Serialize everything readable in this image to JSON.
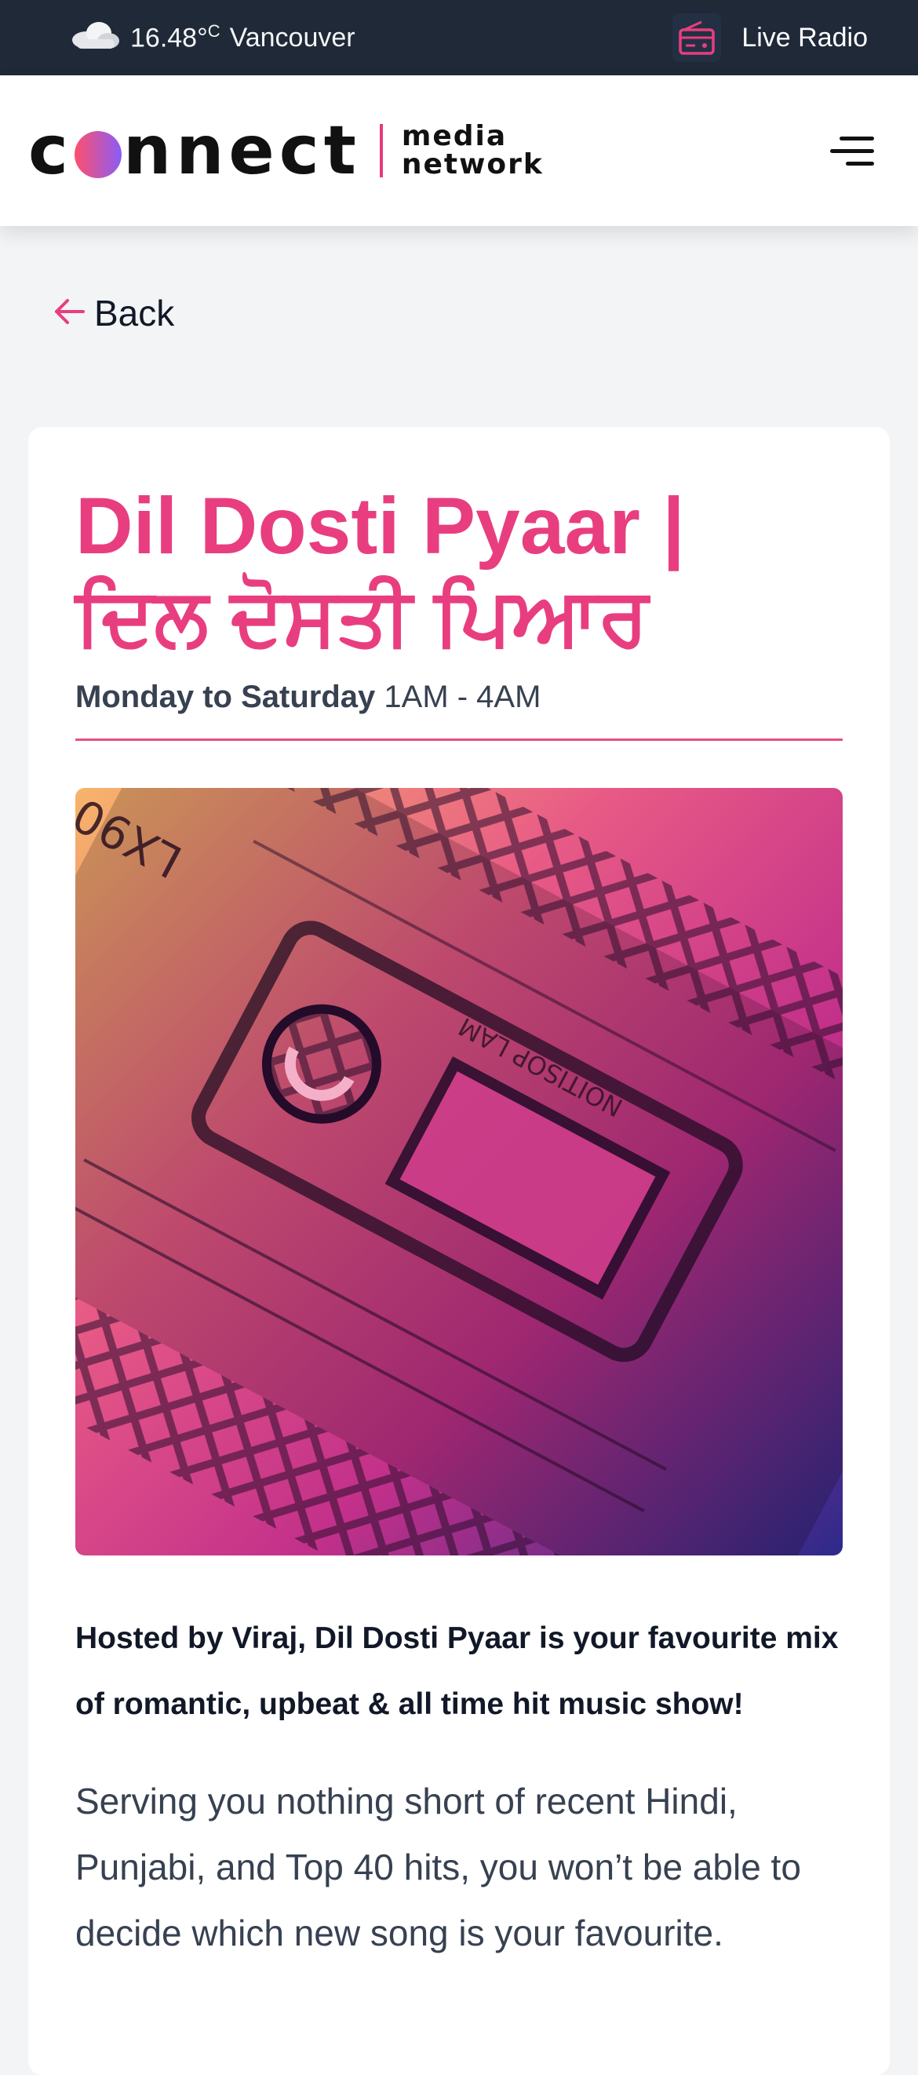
{
  "topbar": {
    "weather_icon": "cloud-icon",
    "temperature": "16.48°",
    "unit": "C",
    "city": "Vancouver",
    "radio_icon": "radio-icon",
    "radio_label": "Live Radio"
  },
  "header": {
    "logo_main": [
      "c",
      "nnect"
    ],
    "logo_sub_1": "media",
    "logo_sub_2": "network",
    "menu_icon": "hamburger-icon"
  },
  "nav": {
    "back_label": "Back",
    "back_icon": "arrow-left-icon"
  },
  "show": {
    "title_line1": "Dil Dosti Pyaar |",
    "title_line2": "ਦਿਲ ਦੋਸਤੀ ਪਿਆਰ",
    "days": "Monday to Saturday",
    "time": "1AM - 4AM",
    "cover_text_1": "LX90",
    "cover_text_2": "NOITISOP LAM",
    "lead": "Hosted by Viraj, Dil Dosti Pyaar is your favourite mix of romantic, upbeat & all time hit music show!",
    "description": "Serving you nothing short of recent Hindi, Punjabi, and Top 40 hits, you won’t be able to decide which new song is your favourite."
  },
  "colors": {
    "accent": "#e83e7f",
    "topbar_bg": "#1f2937"
  }
}
